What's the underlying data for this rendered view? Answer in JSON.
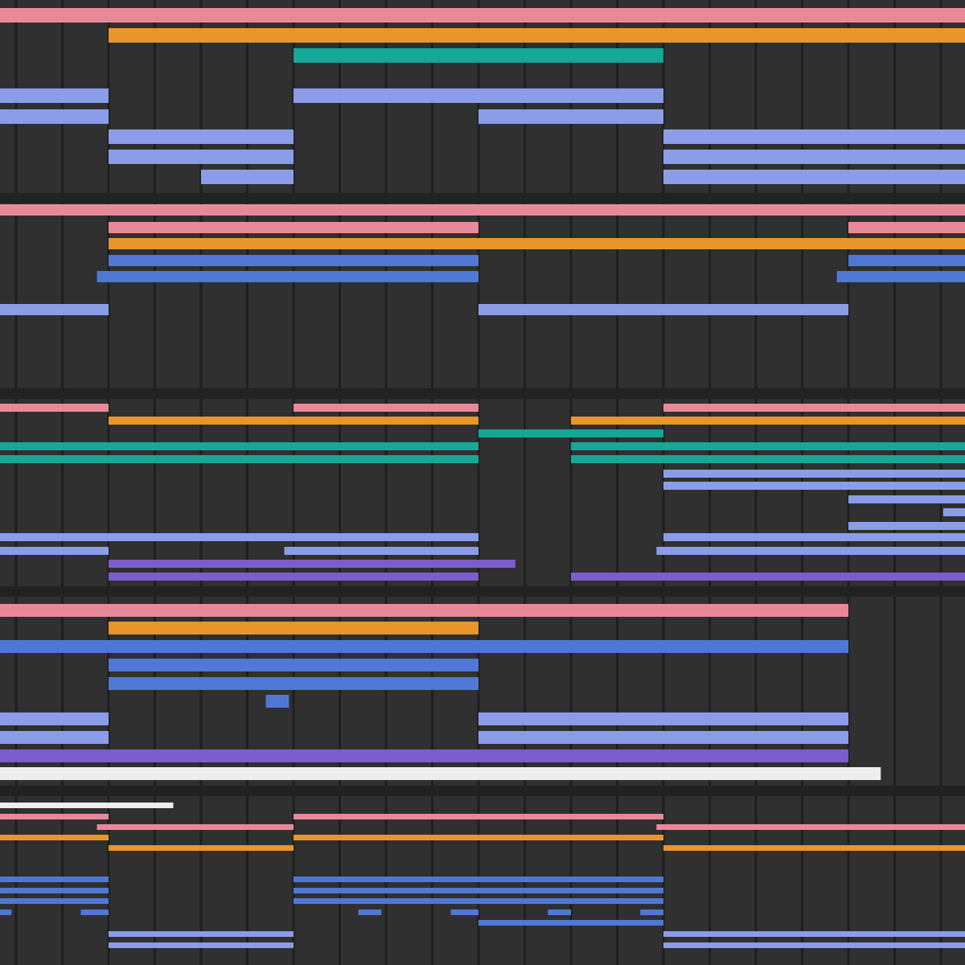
{
  "sections": [
    {
      "lanes": [
        {
          "color": "#e8899a"
        },
        {
          "color": "#e8962c"
        },
        {
          "color": "#14a896"
        },
        {
          "color": "#8b9ce8"
        },
        {
          "color": "#8b9ce8"
        },
        {
          "color": "#8b9ce8"
        },
        {
          "color": "#8b9ce8"
        },
        {
          "color": "#8b9ce8"
        }
      ]
    },
    {
      "lanes": [
        {
          "color": "#e8899a"
        },
        {
          "color": "#e8899a"
        },
        {
          "color": "#e8962c"
        },
        {
          "color": "#4f78d6"
        },
        {
          "color": "#4f78d6"
        },
        {
          "color": "#8b9ce8"
        }
      ]
    },
    {
      "lanes": [
        {
          "color": "#e8899a"
        },
        {
          "color": "#e8962c"
        },
        {
          "color": "#14a896"
        },
        {
          "color": "#14a896"
        },
        {
          "color": "#14a896"
        },
        {
          "color": "#8b9ce8"
        },
        {
          "color": "#8b9ce8"
        },
        {
          "color": "#8b9ce8"
        },
        {
          "color": "#8b9ce8"
        },
        {
          "color": "#8b9ce8"
        },
        {
          "color": "#8b9ce8"
        },
        {
          "color": "#8b9ce8"
        },
        {
          "color": "#7d5ccc"
        },
        {
          "color": "#7d5ccc"
        }
      ]
    },
    {
      "lanes": [
        {
          "color": "#e8899a"
        },
        {
          "color": "#e8962c"
        },
        {
          "color": "#4f78d6"
        },
        {
          "color": "#4f78d6"
        },
        {
          "color": "#4f78d6"
        },
        {
          "color": "#4f78d6"
        },
        {
          "color": "#8b9ce8"
        },
        {
          "color": "#8b9ce8"
        },
        {
          "color": "#7d5ccc"
        },
        {
          "color": "#eeeeee"
        }
      ]
    },
    {
      "lanes": [
        {
          "color": "#eeeeee"
        },
        {
          "color": "#e8899a"
        },
        {
          "color": "#e8899a"
        },
        {
          "color": "#e8962c"
        },
        {
          "color": "#e8962c"
        },
        {
          "color": "#4f78d6"
        },
        {
          "color": "#4f78d6"
        },
        {
          "color": "#4f78d6"
        },
        {
          "color": "#4f78d6"
        },
        {
          "color": "#4f78d6"
        },
        {
          "color": "#8b9ce8"
        },
        {
          "color": "#8b9ce8"
        }
      ]
    }
  ]
}
